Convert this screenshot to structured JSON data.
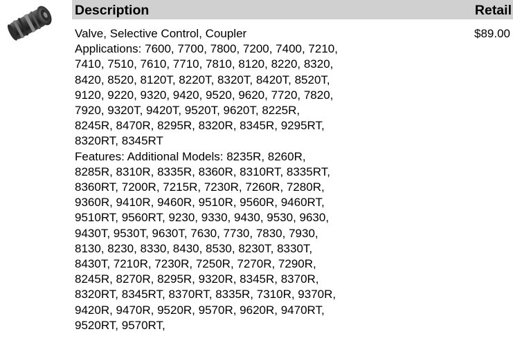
{
  "header": {
    "description": "Description",
    "retail": "Retail"
  },
  "product": {
    "image_icon": "valve-coupler-photo",
    "price": "$89.00",
    "lines": [
      "Valve, Selective Control, Coupler",
      "Applications: 7600, 7700, 7800, 7200, 7400, 7210,",
      "7410, 7510, 7610, 7710, 7810, 8120, 8220, 8320,",
      "8420, 8520, 8120T, 8220T, 8320T, 8420T, 8520T,",
      "9120, 9220, 9320, 9420, 9520, 9620, 7720, 7820,",
      "7920, 9320T, 9420T, 9520T, 9620T, 8225R,",
      "8245R, 8470R, 8295R, 8320R, 8345R, 9295RT,",
      "8320RT, 8345RT",
      "Features:  Additional Models: 8235R, 8260R,",
      "8285R, 8310R, 8335R, 8360R, 8310RT, 8335RT,",
      "8360RT, 7200R, 7215R, 7230R, 7260R, 7280R,",
      "9360R, 9410R, 9460R, 9510R, 9560R, 9460RT,",
      "9510RT, 9560RT, 9230, 9330, 9430, 9530, 9630,",
      "9430T, 9530T, 9630T, 7630, 7730, 7830, 7930,",
      "8130, 8230, 8330, 8430, 8530, 8230T, 8330T,",
      "8430T, 7210R, 7230R, 7250R, 7270R, 7290R,",
      "8245R, 8270R, 8295R, 9320R, 8345R, 8370R,",
      "8320RT, 8345RT, 8370RT, 8335R, 7310R, 9370R,",
      "9420R, 9470R, 9520R, 9570R, 9620R, 9470RT,",
      "9520RT, 9570RT,"
    ]
  },
  "colors": {
    "header_bg": "#d0d0d0",
    "text": "#000000"
  }
}
